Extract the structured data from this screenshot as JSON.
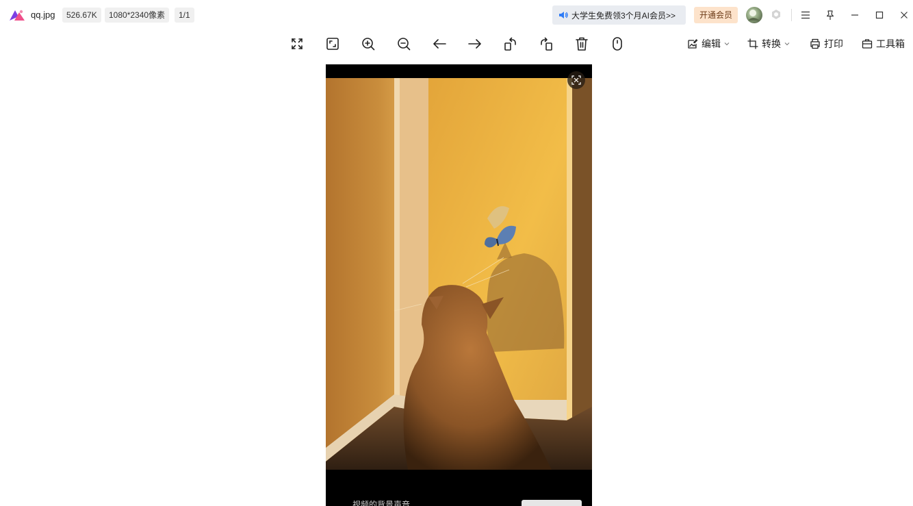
{
  "titlebar": {
    "filename": "qq.jpg",
    "filesize": "526.67K",
    "dimensions": "1080*2340像素",
    "page": "1/1",
    "promo_text": "大学生免费领3个月AI会员>>",
    "vip_button": "开通会员",
    "icons": [
      "app-logo-icon",
      "speaker-icon",
      "avatar",
      "badge-icon",
      "menu-icon",
      "pin-icon",
      "minimize-icon",
      "maximize-icon",
      "close-icon"
    ]
  },
  "toolbar": {
    "tools": [
      {
        "name": "fullscreen-icon"
      },
      {
        "name": "fit-window-icon"
      },
      {
        "name": "zoom-in-icon"
      },
      {
        "name": "zoom-out-icon"
      },
      {
        "name": "previous-icon"
      },
      {
        "name": "next-icon"
      },
      {
        "name": "rotate-left-icon"
      },
      {
        "name": "rotate-right-icon"
      },
      {
        "name": "delete-icon"
      },
      {
        "name": "mouse-icon"
      }
    ],
    "edit_label": "编辑",
    "convert_label": "转换",
    "print_label": "打印",
    "toolbox_label": "工具箱"
  },
  "image": {
    "caption": "视频的背景声音"
  },
  "colors": {
    "promo_bg": "#e9ecf1",
    "vip_bg": "#fde3cb",
    "icon_stroke": "#222222",
    "logo_purple": "#7b3fe4",
    "logo_pink": "#ef4f8a"
  }
}
